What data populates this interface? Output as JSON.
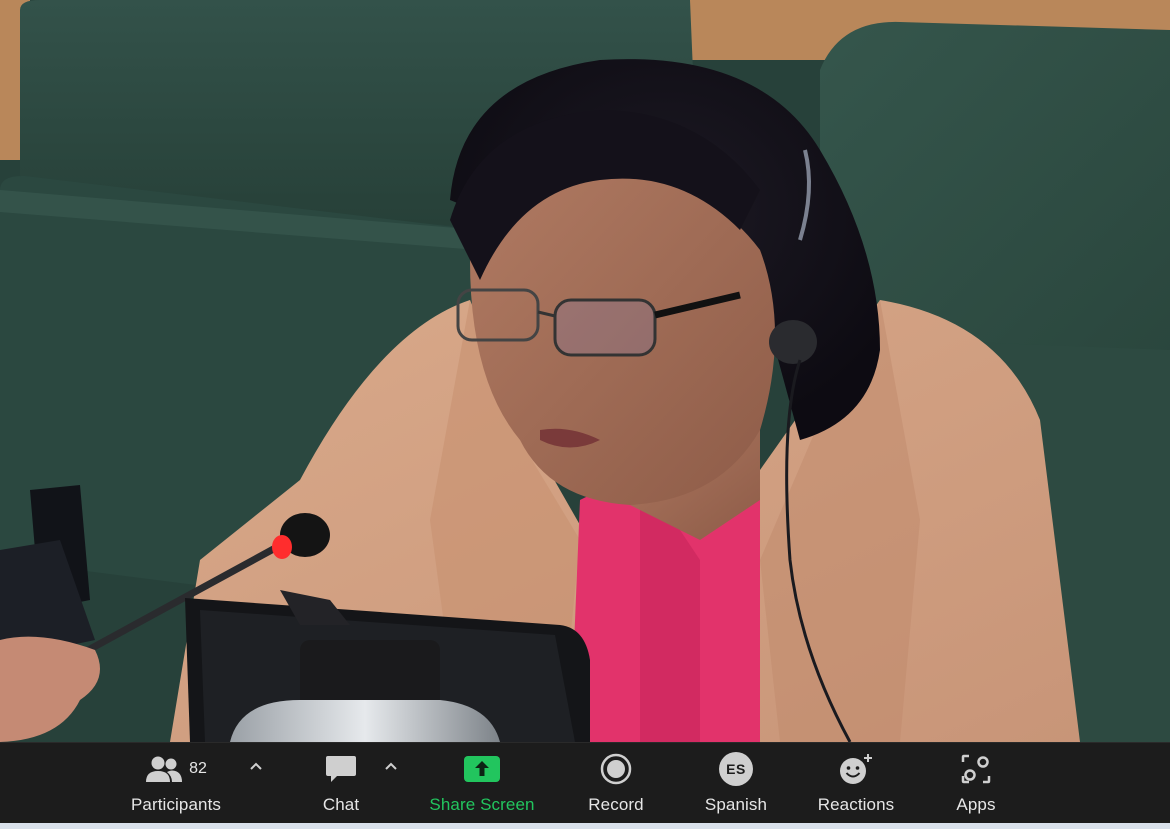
{
  "toolbar": {
    "participants": {
      "label": "Participants",
      "count": "82",
      "icon": "participants-icon"
    },
    "chat": {
      "label": "Chat",
      "icon": "chat-icon"
    },
    "share_screen": {
      "label": "Share Screen",
      "icon": "share-screen-icon",
      "accent": "#22c55e"
    },
    "record": {
      "label": "Record",
      "icon": "record-icon"
    },
    "language": {
      "label": "Spanish",
      "badge": "ES",
      "icon": "language-interpretation-icon"
    },
    "reactions": {
      "label": "Reactions",
      "icon": "reactions-icon"
    },
    "apps": {
      "label": "Apps",
      "icon": "apps-icon"
    }
  },
  "colors": {
    "toolbar_bg": "#1c1c1c",
    "label": "#e6e6e6",
    "share_accent": "#22c55e",
    "seat_green": "#2f4a40"
  }
}
